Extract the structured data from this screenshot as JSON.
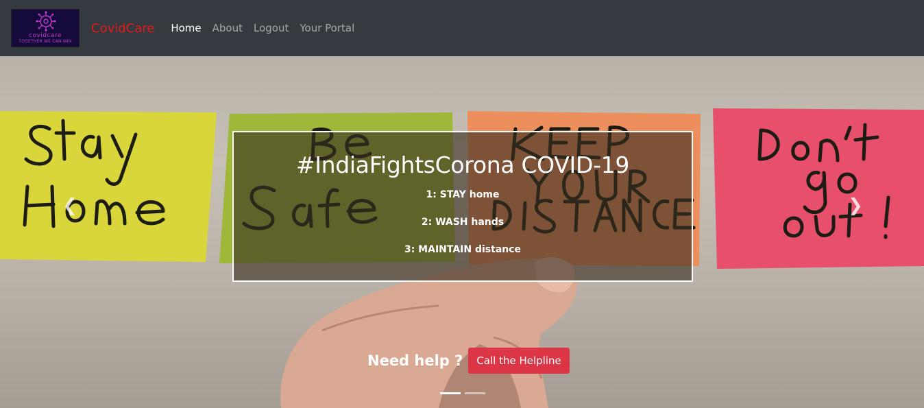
{
  "navbar": {
    "logo": {
      "name": "covidcare",
      "tagline": "TOGETHER WE CAN WIN"
    },
    "brand": "CovidCare",
    "links": [
      {
        "label": "Home",
        "active": true
      },
      {
        "label": "About",
        "active": false
      },
      {
        "label": "Logout",
        "active": false
      },
      {
        "label": "Your Portal",
        "active": false
      }
    ]
  },
  "hero": {
    "sticky_notes": [
      {
        "text": "Stay\nHome",
        "color": "#d8d63a"
      },
      {
        "text": "Be\nSafe",
        "color": "#9fb83a"
      },
      {
        "text": "KEEP\nYOUR\nDISTANCE",
        "color": "#ec8f5c"
      },
      {
        "text": "Don't\ngo\nout!",
        "color": "#e84f6a"
      }
    ],
    "caption": {
      "title": "#IndiaFightsCorona COVID-19",
      "lines": [
        "1: STAY home",
        "2: WASH hands",
        "3: MAINTAIN distance"
      ]
    },
    "help": {
      "text": "Need help ?",
      "button": "Call the Helpline"
    },
    "controls": {
      "prev_icon": "chevron-left-icon",
      "next_icon": "chevron-right-icon"
    },
    "indicators": {
      "count": 2,
      "active": 0
    }
  },
  "colors": {
    "navbar_bg": "#343a40",
    "brand": "#e31b1b",
    "button": "#dc3545"
  }
}
